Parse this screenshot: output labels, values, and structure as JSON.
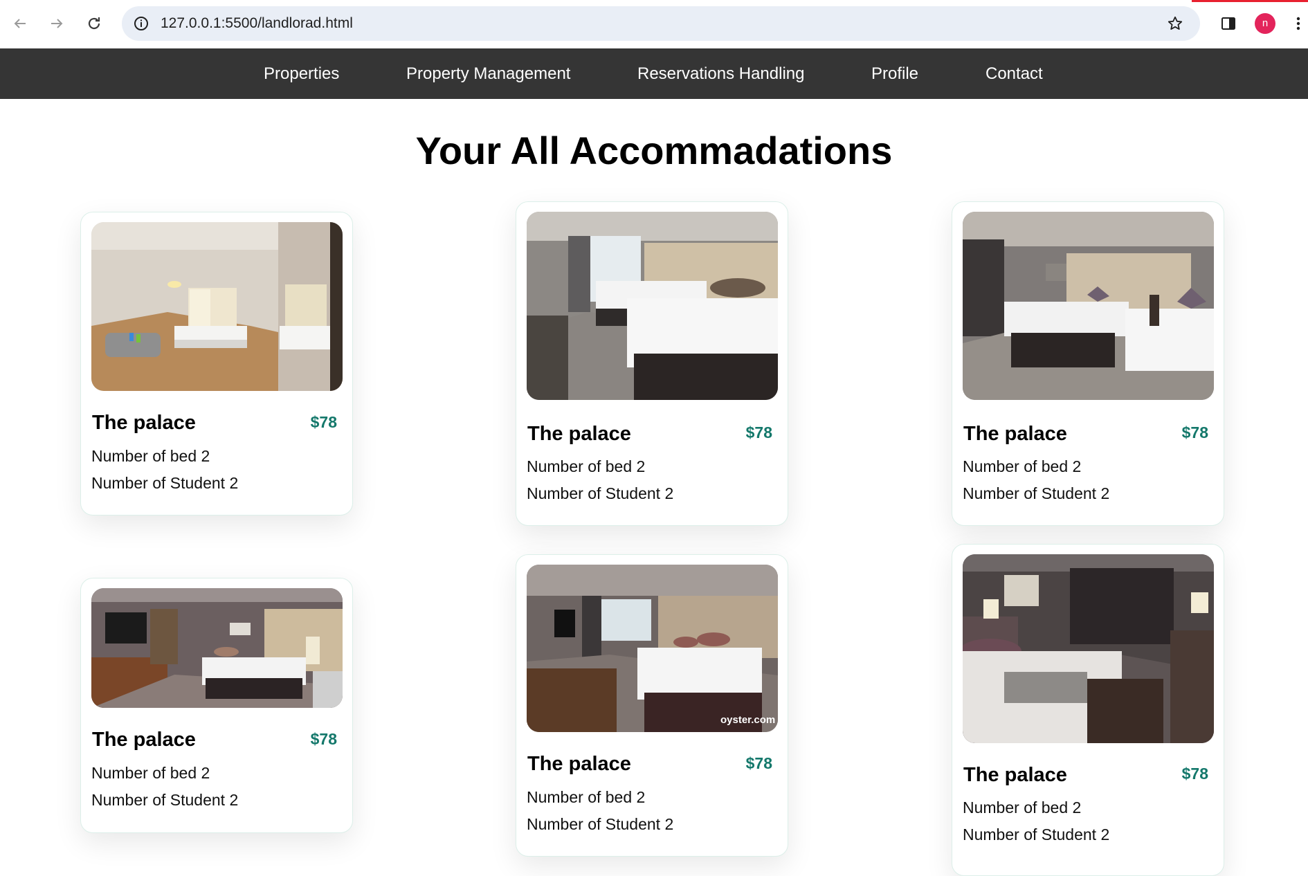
{
  "browser": {
    "url": "127.0.0.1:5500/landlorad.html",
    "profile_initial": "n"
  },
  "nav": {
    "items": [
      {
        "label": "Properties"
      },
      {
        "label": "Property Management"
      },
      {
        "label": "Reservations Handling"
      },
      {
        "label": "Profile"
      },
      {
        "label": "Contact"
      }
    ]
  },
  "page": {
    "title": "Your All Accommadations"
  },
  "cards": [
    {
      "name": "The palace",
      "price": "$78",
      "beds": "Number of bed 2",
      "students": "Number of Student 2",
      "photo": "bright-room-beige"
    },
    {
      "name": "The palace",
      "price": "$78",
      "beds": "Number of bed 2",
      "students": "Number of Student 2",
      "photo": "twin-beds-grey"
    },
    {
      "name": "The palace",
      "price": "$78",
      "beds": "Number of bed 2",
      "students": "Number of Student 2",
      "photo": "twin-beds-grey"
    },
    {
      "name": "The palace",
      "price": "$78",
      "beds": "Number of bed 2",
      "students": "Number of Student 2",
      "photo": "room-with-tv"
    },
    {
      "name": "The palace",
      "price": "$78",
      "beds": "Number of bed 2",
      "students": "Number of Student 2",
      "photo": "room-watermarked",
      "watermark": "oyster.com"
    },
    {
      "name": "The palace",
      "price": "$78",
      "beds": "Number of bed 2",
      "students": "Number of Student 2",
      "photo": "dark-room"
    }
  ],
  "colors": {
    "nav_bg": "#353535",
    "price": "#14786b",
    "card_border": "#dcefe9",
    "avatar": "#e3245b"
  }
}
